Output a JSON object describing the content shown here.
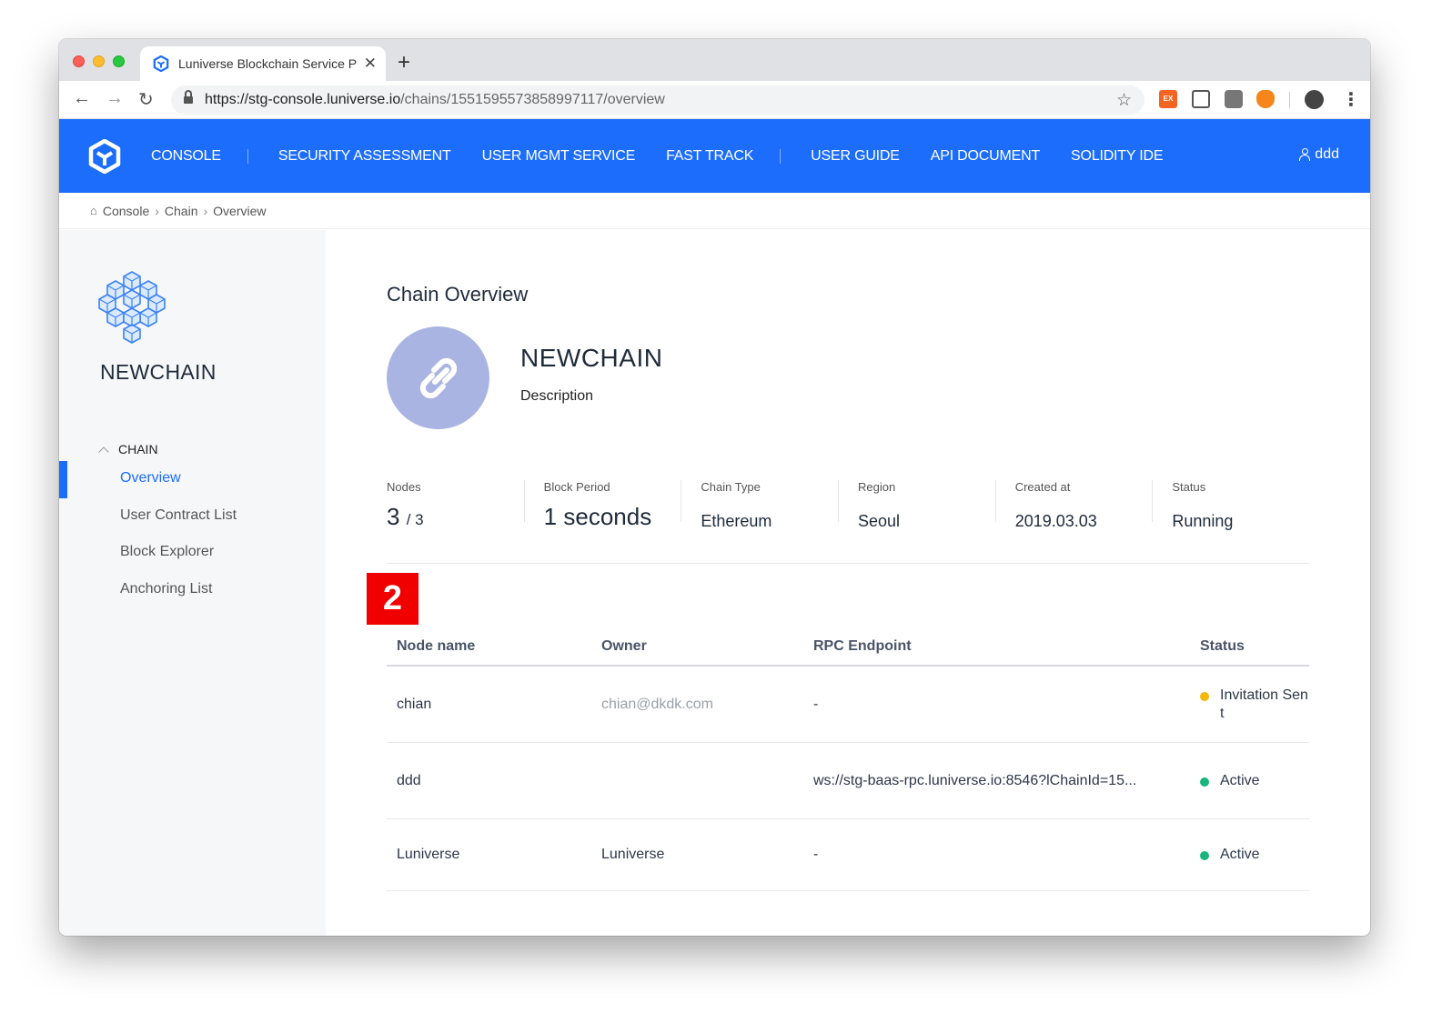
{
  "browser": {
    "tab_title": "Luniverse Blockchain Service P",
    "url_host": "https://stg-console.luniverse.io",
    "url_path": "/chains/1551595573858997117/overview",
    "extension_ex_label": "EX"
  },
  "nav": {
    "items": [
      "CONSOLE",
      "SECURITY ASSESSMENT",
      "USER MGMT SERVICE",
      "FAST TRACK",
      "USER GUIDE",
      "API DOCUMENT",
      "SOLIDITY IDE"
    ],
    "user": "ddd",
    "brand_color": "#1c6dfc"
  },
  "breadcrumb": [
    "Console",
    "Chain",
    "Overview"
  ],
  "sidebar": {
    "chain_name": "NEWCHAIN",
    "section": "CHAIN",
    "items": [
      "Overview",
      "User Contract List",
      "Block Explorer",
      "Anchoring List"
    ],
    "active_item": "Overview"
  },
  "overview": {
    "title": "Chain Overview",
    "chain_name": "NEWCHAIN",
    "description": "Description",
    "stats": [
      {
        "label": "Nodes",
        "value": "3",
        "suffix": "/ 3"
      },
      {
        "label": "Block Period",
        "value": "1 seconds",
        "suffix": ""
      },
      {
        "label": "Chain Type",
        "value": "Ethereum",
        "suffix": ""
      },
      {
        "label": "Region",
        "value": "Seoul",
        "suffix": ""
      },
      {
        "label": "Created at",
        "value": "2019.03.03",
        "suffix": ""
      },
      {
        "label": "Status",
        "value": "Running",
        "suffix": ""
      }
    ]
  },
  "marker": "2",
  "nodes_table": {
    "headers": [
      "Node name",
      "Owner",
      "RPC Endpoint",
      "Status"
    ],
    "rows": [
      {
        "name": "chian",
        "owner": "chian@dkdk.com",
        "rpc": "-",
        "status": "Invitation Sent",
        "status_color": "#f5b70a"
      },
      {
        "name": "ddd",
        "owner": "",
        "rpc": "ws://stg-baas-rpc.luniverse.io:8546?lChainId=15...",
        "status": "Active",
        "status_color": "#19b57c"
      },
      {
        "name": "Luniverse",
        "owner": "Luniverse",
        "rpc": "-",
        "status": "Active",
        "status_color": "#19b57c"
      }
    ]
  }
}
